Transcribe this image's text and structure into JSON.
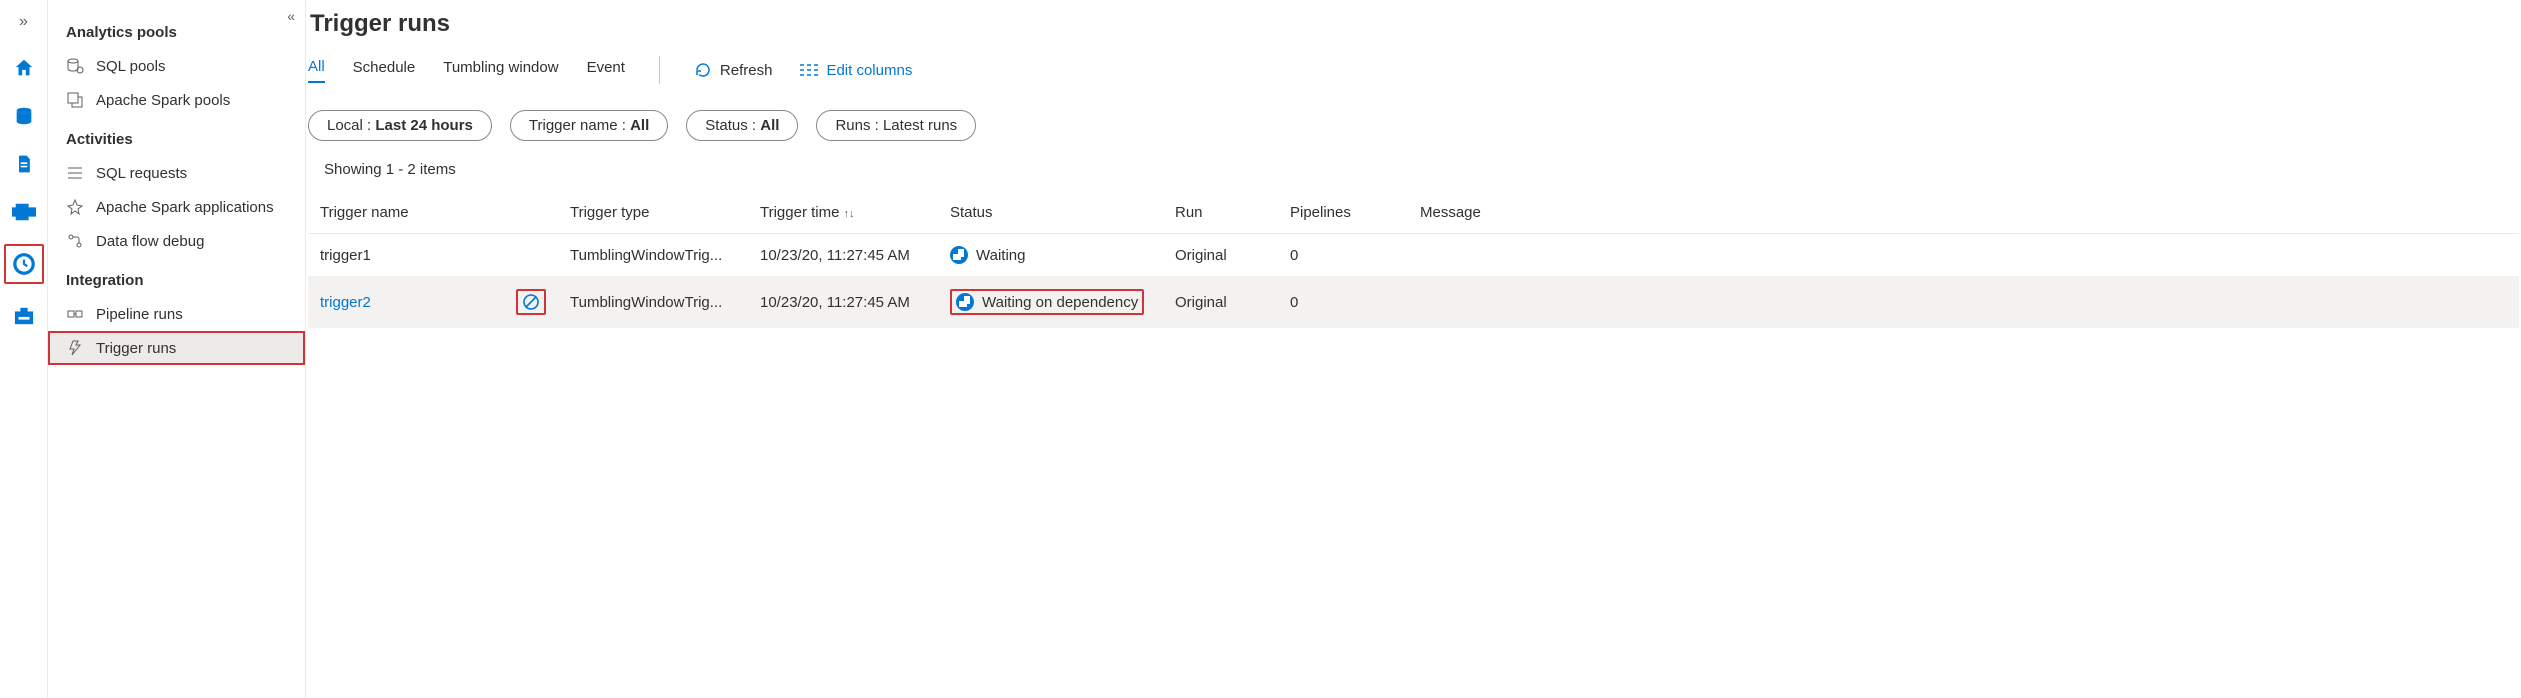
{
  "rail": {
    "items": [
      "home",
      "database",
      "document",
      "pipe",
      "monitor",
      "toolbox"
    ]
  },
  "sidebar": {
    "sections": [
      {
        "title": "Analytics pools",
        "items": [
          {
            "label": "SQL pools",
            "icon": "sql"
          },
          {
            "label": "Apache Spark pools",
            "icon": "spark"
          }
        ]
      },
      {
        "title": "Activities",
        "items": [
          {
            "label": "SQL requests",
            "icon": "sqlreq"
          },
          {
            "label": "Apache Spark applications",
            "icon": "sparkapp"
          },
          {
            "label": "Data flow debug",
            "icon": "dataflow"
          }
        ]
      },
      {
        "title": "Integration",
        "items": [
          {
            "label": "Pipeline runs",
            "icon": "pipeline"
          },
          {
            "label": "Trigger runs",
            "icon": "trigger",
            "selected": true,
            "redbox": true
          }
        ]
      }
    ]
  },
  "header": {
    "title": "Trigger runs"
  },
  "tabs": {
    "items": [
      "All",
      "Schedule",
      "Tumbling window",
      "Event"
    ],
    "active": "All",
    "refresh_label": "Refresh",
    "edit_columns_label": "Edit columns"
  },
  "filters": [
    {
      "prefix": "Local : ",
      "bold": "Last 24 hours"
    },
    {
      "prefix": "Trigger name : ",
      "bold": "All"
    },
    {
      "prefix": "Status : ",
      "bold": "All"
    },
    {
      "prefix": "Runs : ",
      "bold": "Latest runs",
      "bold_weight": "normal"
    }
  ],
  "showing": "Showing 1 - 2 items",
  "table": {
    "columns": [
      "Trigger name",
      "Trigger type",
      "Trigger time",
      "Status",
      "Run",
      "Pipelines",
      "Message"
    ],
    "rows": [
      {
        "name": "trigger1",
        "type": "TumblingWindowTrig...",
        "time": "10/23/20, 11:27:45 AM",
        "status": "Waiting",
        "run": "Original",
        "pipelines": "0",
        "message": ""
      },
      {
        "name": "trigger2",
        "link": true,
        "cancel": true,
        "type": "TumblingWindowTrig...",
        "time": "10/23/20, 11:27:45 AM",
        "status": "Waiting on dependency",
        "status_redbox": true,
        "run": "Original",
        "pipelines": "0",
        "message": "",
        "hover": true
      }
    ]
  }
}
